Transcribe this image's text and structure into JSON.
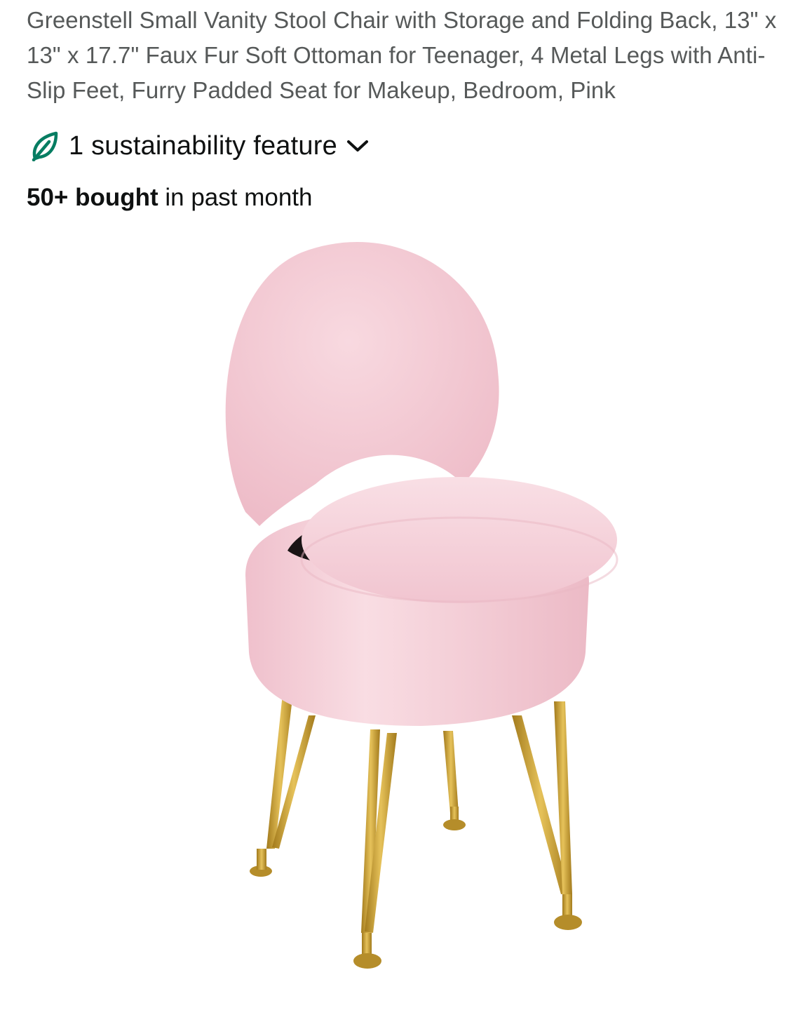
{
  "product": {
    "title": "Greenstell Small Vanity Stool Chair with Storage and Folding Back, 13\" x 13\" x 17.7\" Faux Fur Soft Ottoman for Teenager, 4 Metal Legs with Anti-Slip Feet, Furry Padded Seat for Makeup, Bedroom, Pink"
  },
  "sustainability": {
    "label": "1 sustainability feature",
    "icon": "leaf-icon",
    "expand_icon": "chevron-down-icon",
    "icon_color": "#067d62"
  },
  "social_proof": {
    "count": "50+ bought",
    "suffix": " in past month"
  },
  "image": {
    "subject": "pink faux fur vanity stool with gold hairpin legs",
    "colors": {
      "fur": "#f4c9d3",
      "gold": "#c9a133"
    }
  }
}
